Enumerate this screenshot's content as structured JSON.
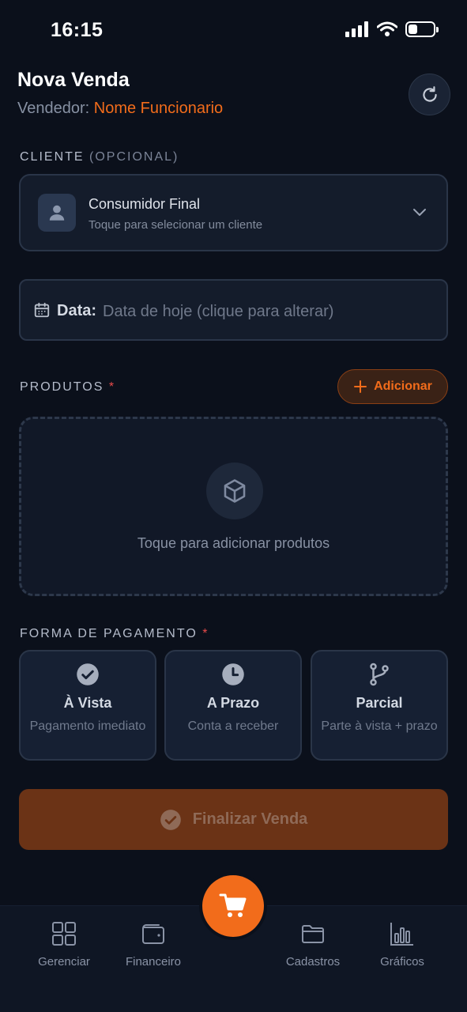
{
  "status_bar": {
    "time": "16:15"
  },
  "header": {
    "title": "Nova Venda",
    "vendor_label": "Vendedor:",
    "vendor_name": "Nome Funcionario"
  },
  "client": {
    "section_label": "CLIENTE",
    "section_optional": "(OPCIONAL)",
    "name": "Consumidor Final",
    "hint": "Toque para selecionar um cliente"
  },
  "date": {
    "label": "Data:",
    "placeholder": "Data de hoje (clique para alterar)"
  },
  "products": {
    "section_label": "PRODUTOS",
    "required_mark": "*",
    "add_label": "Adicionar",
    "empty_text": "Toque para adicionar produtos"
  },
  "payment": {
    "section_label": "FORMA DE PAGAMENTO",
    "required_mark": "*",
    "options": [
      {
        "title": "À Vista",
        "subtitle": "Pagamento imediato",
        "icon": "check-circle-icon"
      },
      {
        "title": "A Prazo",
        "subtitle": "Conta a receber",
        "icon": "clock-icon"
      },
      {
        "title": "Parcial",
        "subtitle": "Parte à vista + prazo",
        "icon": "branch-icon"
      }
    ]
  },
  "finalize": {
    "label": "Finalizar Venda"
  },
  "bottom_nav": {
    "items": [
      {
        "label": "Gerenciar",
        "icon": "grid-icon"
      },
      {
        "label": "Financeiro",
        "icon": "wallet-icon"
      },
      {
        "label": "Cadastros",
        "icon": "folder-icon"
      },
      {
        "label": "Gráficos",
        "icon": "bar-chart-icon"
      }
    ],
    "center_icon": "cart-icon"
  },
  "colors": {
    "accent": "#f26c1b",
    "background": "#0b101b",
    "card": "#141c2b"
  }
}
